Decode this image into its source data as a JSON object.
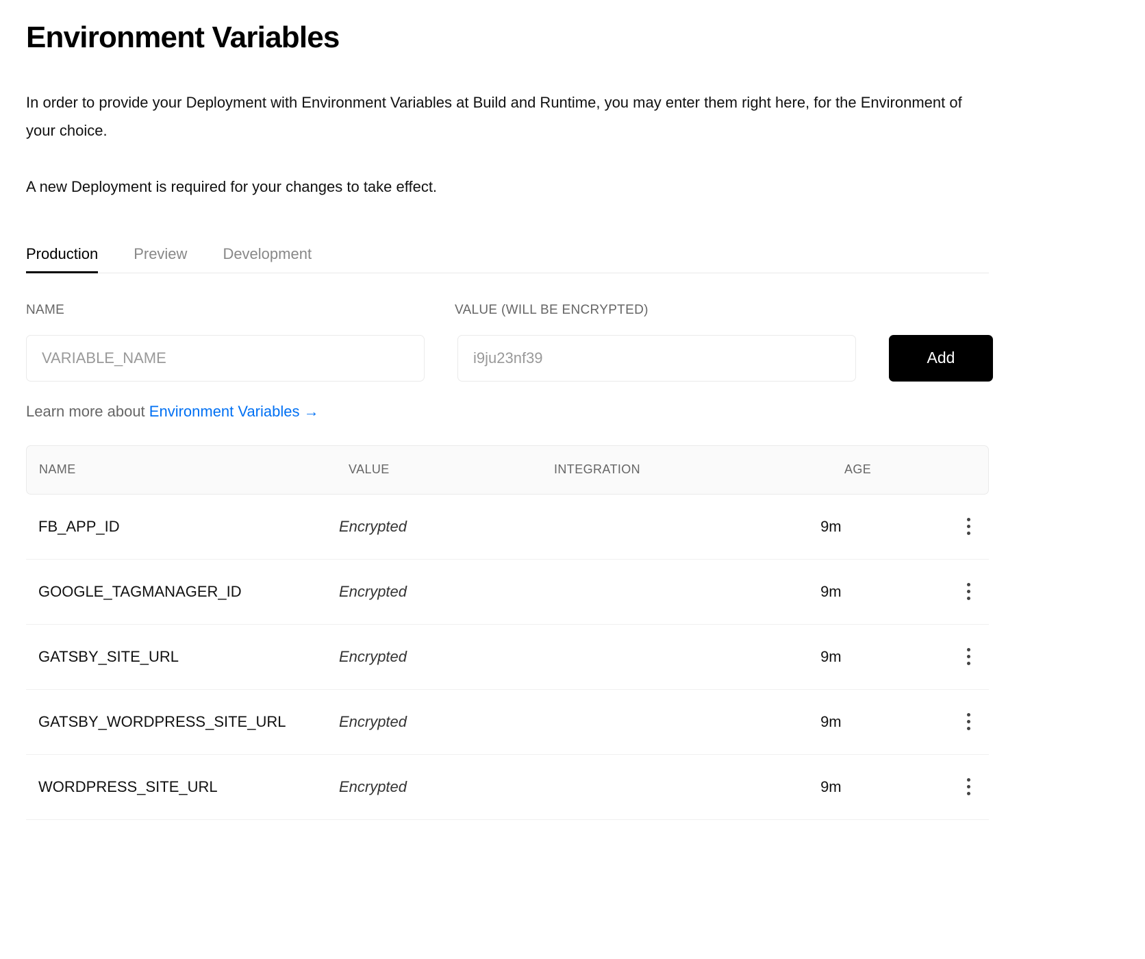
{
  "header": {
    "title": "Environment Variables",
    "paragraph_1": "In order to provide your Deployment with Environment Variables at Build and Runtime, you may enter them right here, for the Environment of your choice.",
    "paragraph_2": "A new Deployment is required for your changes to take effect."
  },
  "tabs": [
    {
      "label": "Production",
      "active": true
    },
    {
      "label": "Preview",
      "active": false
    },
    {
      "label": "Development",
      "active": false
    }
  ],
  "form": {
    "name_label": "NAME",
    "value_label": "VALUE (WILL BE ENCRYPTED)",
    "name_value": "",
    "name_placeholder": "VARIABLE_NAME",
    "value_value": "",
    "value_placeholder": "i9ju23nf39",
    "add_label": "Add"
  },
  "learn_more": {
    "prefix": "Learn more about ",
    "link_label": "Environment Variables →"
  },
  "table": {
    "columns": [
      "NAME",
      "VALUE",
      "INTEGRATION",
      "AGE"
    ],
    "rows": [
      {
        "name": "FB_APP_ID",
        "value": "Encrypted",
        "integration": "",
        "age": "9m"
      },
      {
        "name": "GOOGLE_TAGMANAGER_ID",
        "value": "Encrypted",
        "integration": "",
        "age": "9m"
      },
      {
        "name": "GATSBY_SITE_URL",
        "value": "Encrypted",
        "integration": "",
        "age": "9m"
      },
      {
        "name": "GATSBY_WORDPRESS_SITE_URL",
        "value": "Encrypted",
        "integration": "",
        "age": "9m"
      },
      {
        "name": "WORDPRESS_SITE_URL",
        "value": "Encrypted",
        "integration": "",
        "age": "9m"
      }
    ]
  },
  "colors": {
    "accent_link": "#0070f3",
    "button_bg": "#000000",
    "muted_text": "#666666",
    "border": "#eaeaea"
  }
}
